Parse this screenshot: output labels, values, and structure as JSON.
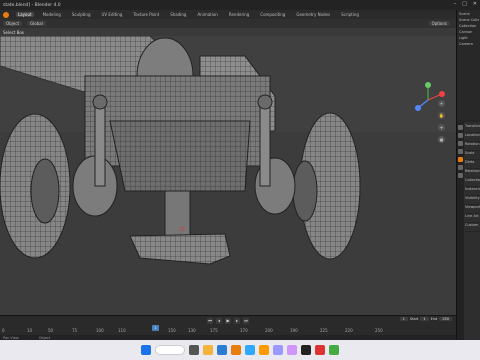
{
  "window": {
    "title": "state.blend] - Blender 4.0"
  },
  "menubar": {
    "tabs": [
      "Layout",
      "Modeling",
      "Sculpting",
      "UV Editing",
      "Texture Paint",
      "Shading",
      "Animation",
      "Rendering",
      "Compositing",
      "Geometry Nodes",
      "Scripting"
    ],
    "active_tab": "Layout",
    "scene": "Scene"
  },
  "header": {
    "mode": "Object",
    "transform": "Global",
    "select": "Select Box",
    "options": "Options"
  },
  "outliner": {
    "items": [
      "Scene Collection",
      "Collection",
      "Cannon",
      "Light",
      "Camera"
    ]
  },
  "properties": {
    "rows": [
      "Transform",
      "Location",
      "Rotation",
      "Scale",
      "Delta",
      "Relations",
      "Collections",
      "Instancing",
      "Visibility",
      "Viewport",
      "Line Art",
      "Custom"
    ]
  },
  "timeline": {
    "start_label": "Start",
    "start": "1",
    "end_label": "End",
    "end": "250",
    "current_frame": "1",
    "ticks": [
      "0",
      "25",
      "50",
      "75",
      "100",
      "125",
      "150",
      "175",
      "200",
      "225",
      "250"
    ],
    "frame_marks": [
      "10",
      "30",
      "60",
      "80",
      "110",
      "130",
      "170",
      "190",
      "220"
    ]
  },
  "status": {
    "left": "Pan View",
    "right": "Object"
  },
  "colors": {
    "accent": "#e87d0d",
    "select": "#4a7fc0"
  }
}
